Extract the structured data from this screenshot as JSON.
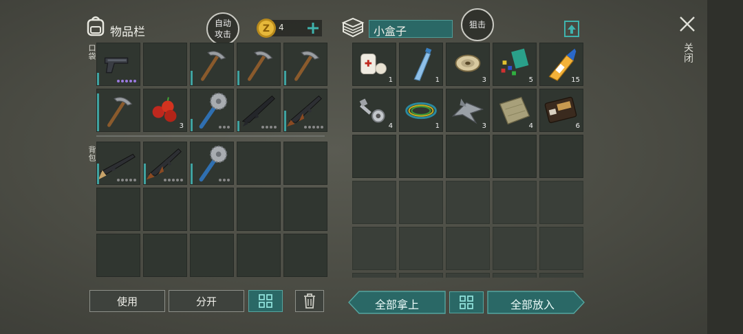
{
  "inventory": {
    "title": "物品栏",
    "auto_attack": [
      "自动",
      "攻击"
    ],
    "coins": "4",
    "pocket_label": "口袋",
    "backpack_label": "背包",
    "pocket_slots": [
      {
        "item": "pistol",
        "dots": 5,
        "dot_color": "purple",
        "durability": 0.3
      },
      {
        "item": "empty"
      },
      {
        "item": "pickaxe",
        "durability": 0.35
      },
      {
        "item": "pickaxe",
        "durability": 0.35
      },
      {
        "item": "pickaxe",
        "durability": 0.35
      },
      {
        "item": "pickaxe",
        "durability": 0.9
      },
      {
        "item": "apples",
        "count": "3"
      },
      {
        "item": "saw-mace",
        "dots": 3,
        "durability": 0.3
      },
      {
        "item": "rifle",
        "dots": 4,
        "durability": 0.25
      },
      {
        "item": "ak-rifle",
        "dots": 5,
        "durability": 0.5
      }
    ],
    "backpack_slots": [
      {
        "item": "shotgun",
        "dots": 5,
        "durability": 0.5
      },
      {
        "item": "ak-rifle",
        "dots": 5,
        "durability": 0.5
      },
      {
        "item": "saw-mace",
        "dots": 3,
        "durability": 0.5
      }
    ]
  },
  "container": {
    "title": "小盒子",
    "snipe_button": "狙击",
    "slots": [
      {
        "item": "bandage",
        "count": "1"
      },
      {
        "item": "water-bottle",
        "count": "1"
      },
      {
        "item": "wire-spool",
        "count": "3"
      },
      {
        "item": "plastic-pieces",
        "count": "5"
      },
      {
        "item": "glue",
        "count": "15"
      },
      {
        "item": "bolts",
        "count": "4"
      },
      {
        "item": "wires",
        "count": "1"
      },
      {
        "item": "metal-scraps",
        "count": "3"
      },
      {
        "item": "cloth",
        "count": "4"
      },
      {
        "item": "wallet",
        "count": "6"
      }
    ]
  },
  "buttons": {
    "use": "使用",
    "split": "分开",
    "take_all": "全部拿上",
    "put_all": "全部放入",
    "close": "关闭"
  }
}
